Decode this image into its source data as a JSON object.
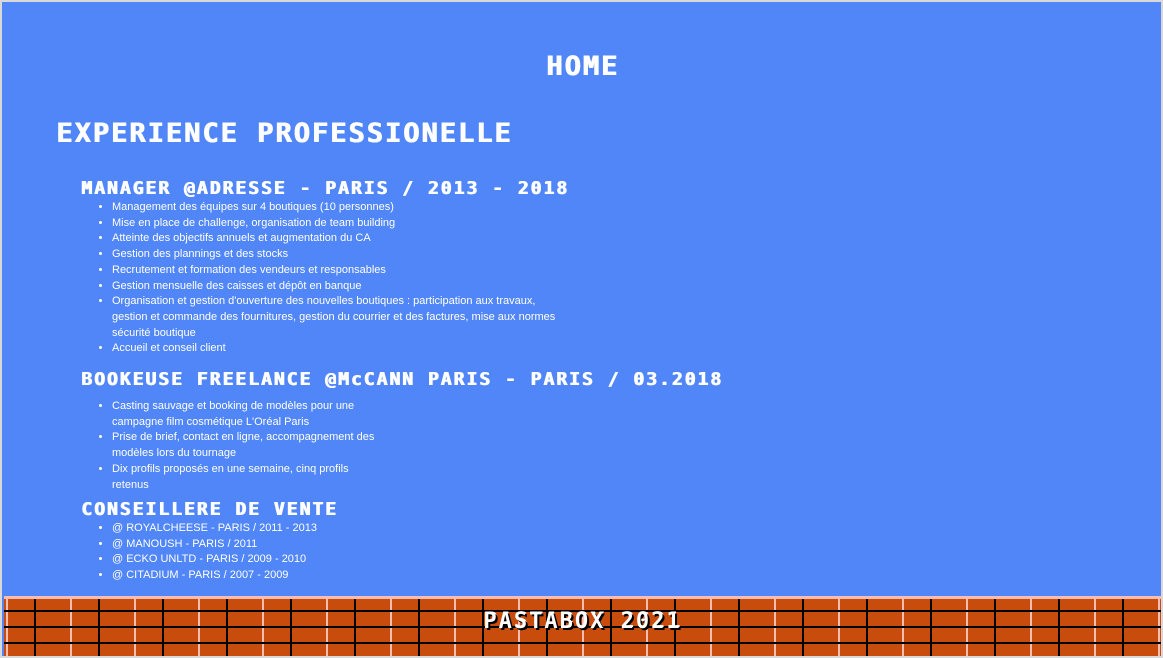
{
  "nav": {
    "home": "HOME"
  },
  "section": {
    "title": "EXPERIENCE PROFESSIONELLE"
  },
  "jobs": [
    {
      "title": "MANAGER @ADRESSE - PARIS / 2013 - 2018",
      "bullets": [
        "Management des équipes sur 4 boutiques (10 personnes)",
        "Mise en place de challenge, organisation de team building",
        "Atteinte des objectifs annuels et augmentation du CA",
        "Gestion des plannings et des stocks",
        "Recrutement et formation des vendeurs et responsables",
        "Gestion mensuelle des caisses et dépôt en banque",
        "Organisation et gestion d'ouverture des nouvelles boutiques : participation aux travaux, gestion et commande des fournitures, gestion du courrier et des factures, mise aux normes sécurité boutique",
        "Accueil et conseil client"
      ]
    },
    {
      "title": "BOOKEUSE FREELANCE @McCANN PARIS - PARIS / 03.2018",
      "bullets": [
        "Casting sauvage et booking de modèles pour une campagne film cosmétique L'Oréal Paris",
        "Prise de brief, contact en ligne, accompagnement des modèles lors du tournage",
        "Dix profils proposés en une semaine, cinq profils retenus"
      ]
    },
    {
      "title": "CONSEILLERE DE VENTE",
      "bullets": [
        "@ ROYALCHEESE - PARIS / 2011 - 2013",
        "@ MANOUSH - PARIS / 2011",
        "@ ECKO UNLTD - PARIS / 2009 - 2010",
        "@ CITADIUM - PARIS / 2007 - 2009"
      ]
    }
  ],
  "footer": {
    "text": "PASTABOX 2021"
  }
}
